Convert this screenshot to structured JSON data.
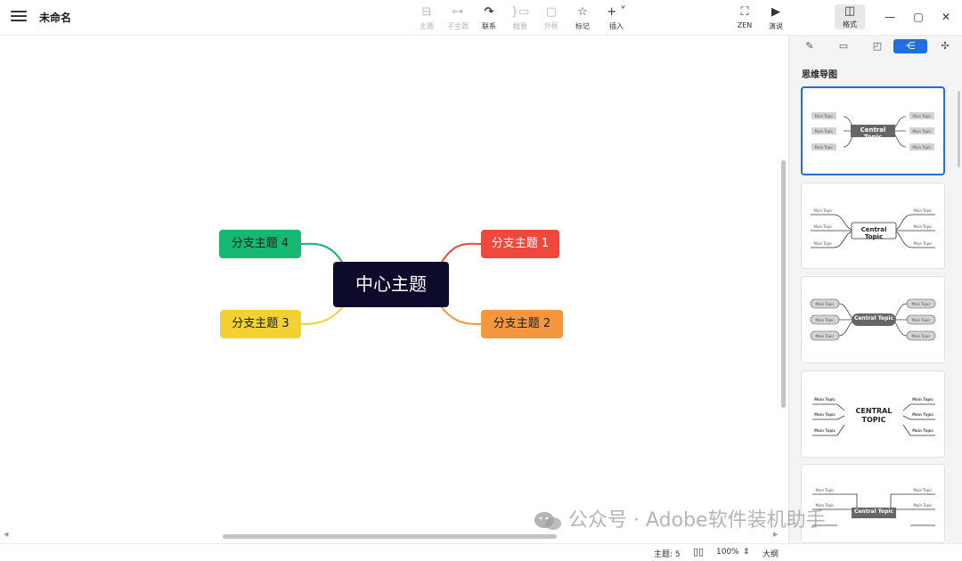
{
  "window": {
    "title": "未命名"
  },
  "toolbar": {
    "items": [
      {
        "label": "主题",
        "icon": "topic-icon",
        "glyph": "⊟",
        "disabled": true
      },
      {
        "label": "子主题",
        "icon": "subtopic-icon",
        "glyph": "⊶",
        "disabled": true
      },
      {
        "label": "联系",
        "icon": "relationship-icon",
        "glyph": "↷",
        "disabled": false
      },
      {
        "label": "概要",
        "icon": "summary-icon",
        "glyph": "}▭",
        "disabled": true
      },
      {
        "label": "外框",
        "icon": "boundary-icon",
        "glyph": "▢",
        "disabled": true
      },
      {
        "label": "标记",
        "icon": "star-icon",
        "glyph": "☆",
        "disabled": false
      },
      {
        "label": "插入",
        "icon": "insert-icon",
        "glyph": "+ ˅",
        "disabled": false
      }
    ],
    "right": [
      {
        "label": "ZEN",
        "icon": "zen-icon",
        "glyph": "⛶"
      },
      {
        "label": "演说",
        "icon": "pitch-icon",
        "glyph": "▶"
      },
      {
        "label": "格式",
        "icon": "format-icon",
        "glyph": "◫"
      }
    ]
  },
  "mindmap": {
    "central": "中心主题",
    "branches": [
      "分支主题 1",
      "分支主题 2",
      "分支主题 3",
      "分支主题 4"
    ],
    "colors": {
      "central": "#0d0a2c",
      "branch1": "#f0483d",
      "branch2": "#f5973f",
      "branch3": "#f3d130",
      "branch4": "#16b871"
    }
  },
  "panel": {
    "tabs": [
      "style-icon",
      "slide-icon",
      "sticker-icon",
      "structure-icon",
      "theme-icon"
    ],
    "title": "思维导图",
    "templates": [
      {
        "central": "Central Topic",
        "main": "Main Topic"
      },
      {
        "central": "Central Topic",
        "main": "Main Topic"
      },
      {
        "central": "Central Topic",
        "main": "Main Topic"
      },
      {
        "central": "CENTRAL TOPIC",
        "main": "Main Topic"
      },
      {
        "central": "Central Topic",
        "main": "Main Topic"
      }
    ]
  },
  "status": {
    "topics": "主题: 5",
    "zoom": "100%",
    "outline": "大纲"
  },
  "watermark": "公众号 · Adobe软件装机助手",
  "accent": "#1f6fe0"
}
